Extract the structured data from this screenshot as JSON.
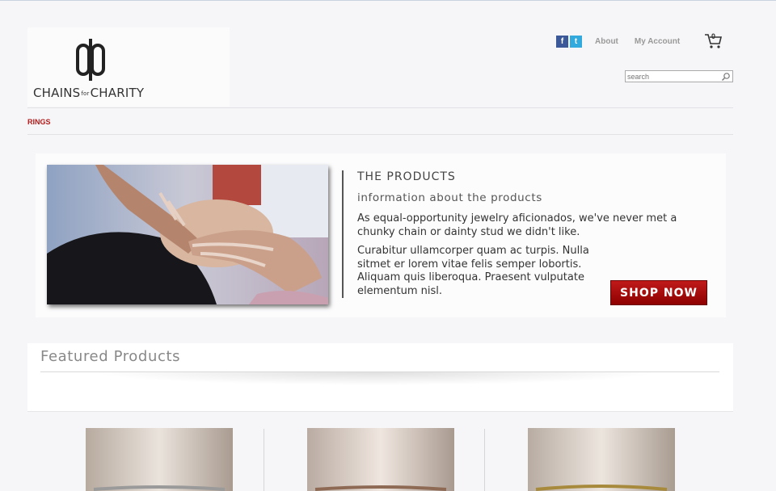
{
  "brand": {
    "logo_text_left": "CHAINS",
    "logo_text_mid": "for",
    "logo_text_right": "CHARITY"
  },
  "topnav": {
    "facebook_glyph": "f",
    "twitter_glyph": "t",
    "about_label": "About",
    "account_label": "My Account",
    "cart_count": "0"
  },
  "search": {
    "placeholder": "search"
  },
  "category_nav": {
    "rings_label": "RINGS"
  },
  "promo": {
    "title": "THE PRODUCTS",
    "subtitle": "information about the products",
    "paragraph1": "As equal-opportunity jewelry aficionados, we've never met a chunky chain or dainty stud we didn't like.",
    "paragraph2": "Curabitur ullamcorper quam ac turpis. Nulla sitmet er lorem vitae felis semper lobortis. Aliquam quis liberoqua. Praesent vulputate elementum nisl.",
    "shop_button": "SHOP NOW"
  },
  "featured": {
    "title": "Featured Products"
  },
  "colors": {
    "accent_red": "#a80d0d",
    "nav_red": "#b21a1a",
    "facebook": "#3b5998",
    "twitter": "#33aadd"
  }
}
